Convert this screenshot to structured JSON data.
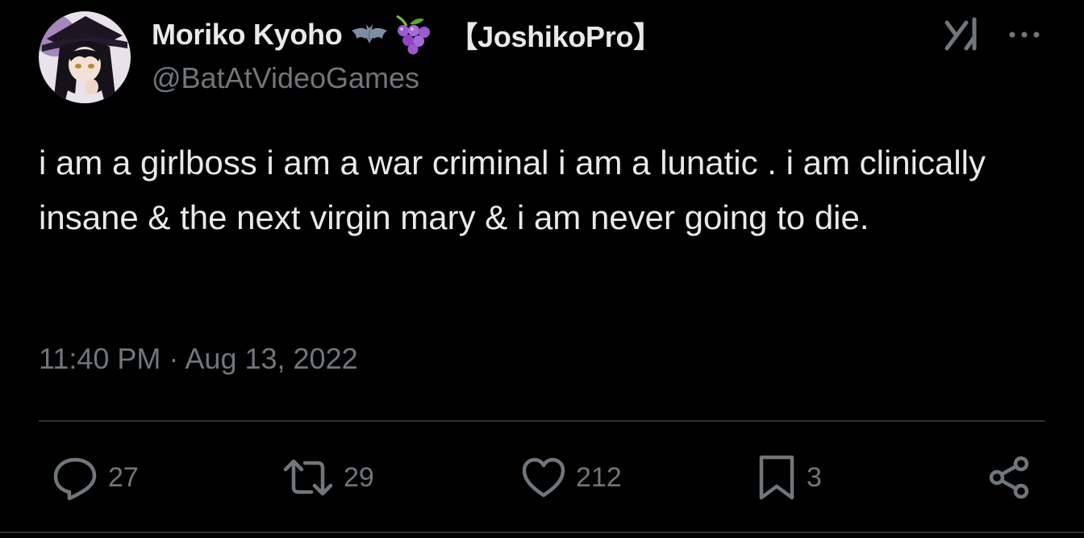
{
  "tweet": {
    "author": {
      "display_name": "Moriko Kyoho",
      "name_emojis": [
        "bat-emoji",
        "grapes-emoji"
      ],
      "tag": "【JoshikoPro】",
      "handle": "@BatAtVideoGames"
    },
    "text": "i am a girlboss i am a war criminal i am a lunatic . i am clinically insane & the next virgin mary & i am never going to die.",
    "timestamp": "11:40 PM · Aug 13, 2022",
    "actions": {
      "replies": "27",
      "reposts": "29",
      "likes": "212",
      "bookmarks": "3"
    },
    "icons": [
      "grok-icon",
      "more-icon",
      "reply-icon",
      "repost-icon",
      "like-icon",
      "bookmark-icon",
      "share-icon"
    ]
  },
  "colors": {
    "background": "#000000",
    "primary_text": "#e7e9ea",
    "secondary_text": "#71767b",
    "divider": "#2f3336"
  }
}
